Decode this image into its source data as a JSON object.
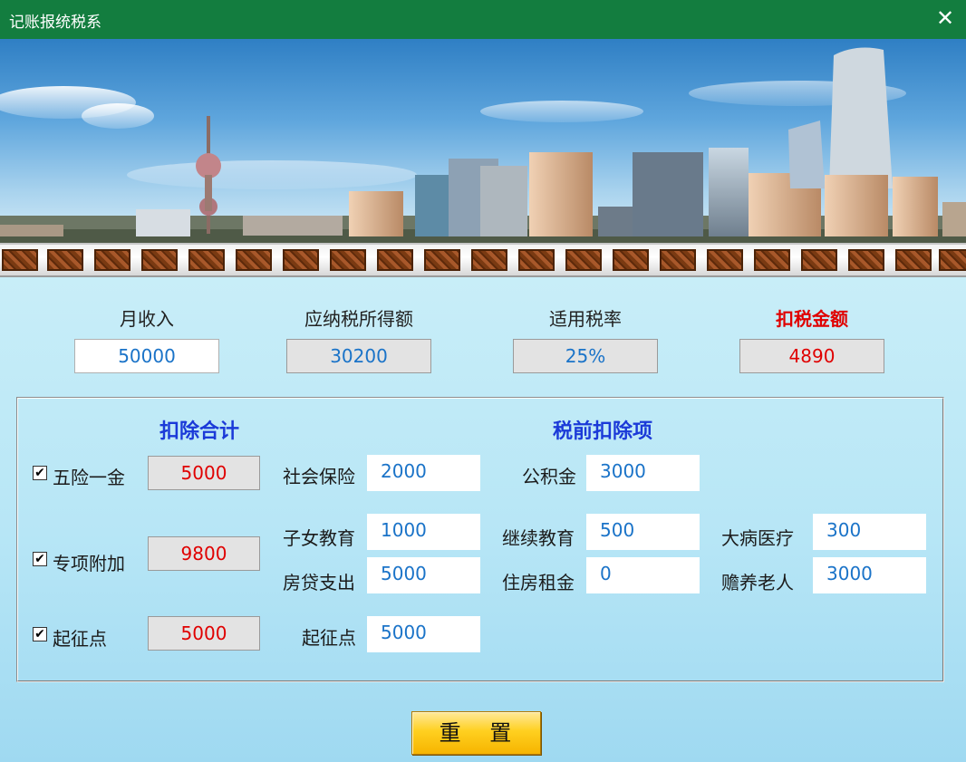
{
  "window": {
    "title": "记账报统税系",
    "close_glyph": "✕"
  },
  "summary": {
    "monthly_income_label": "月收入",
    "monthly_income": "50000",
    "taxable_income_label": "应纳税所得额",
    "taxable_income": "30200",
    "tax_rate_label": "适用税率",
    "tax_rate": "25%",
    "tax_amount_label": "扣税金额",
    "tax_amount": "4890"
  },
  "deductions": {
    "total_title": "扣除合计",
    "items_title": "税前扣除项",
    "insurance_fund": {
      "label": "五险一金",
      "checked": true,
      "check_glyph": "✔",
      "total": "5000"
    },
    "special": {
      "label": "专项附加",
      "checked": true,
      "check_glyph": "✔",
      "total": "9800"
    },
    "threshold": {
      "label": "起征点",
      "checked": true,
      "check_glyph": "✔",
      "total": "5000"
    },
    "social_insurance": {
      "label": "社会保险",
      "value": "2000"
    },
    "housing_fund": {
      "label": "公积金",
      "value": "3000"
    },
    "child_education": {
      "label": "子女教育",
      "value": "1000"
    },
    "continuing_education": {
      "label": "继续教育",
      "value": "500"
    },
    "serious_illness": {
      "label": "大病医疗",
      "value": "300"
    },
    "mortgage": {
      "label": "房贷支出",
      "value": "5000"
    },
    "rent": {
      "label": "住房租金",
      "value": "0"
    },
    "elderly_support": {
      "label": "赡养老人",
      "value": "3000"
    },
    "threshold_value": {
      "label": "起征点",
      "value": "5000"
    }
  },
  "reset_button": "重 置",
  "colors": {
    "titlebar": "#137d3f",
    "accent_blue": "#1a73c8",
    "section_blue": "#1b3ad8",
    "alert_red": "#e00000"
  }
}
